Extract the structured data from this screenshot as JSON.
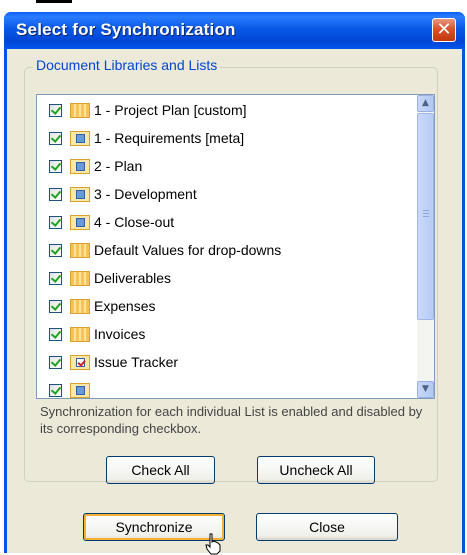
{
  "dialog": {
    "title": "Select for Synchronization",
    "close_glyph": "✕"
  },
  "group": {
    "label": "Document Libraries and Lists"
  },
  "list": {
    "items": [
      {
        "label": "1 - Project Plan [custom]",
        "checked": true,
        "icon": "list-icon"
      },
      {
        "label": "1 - Requirements [meta]",
        "checked": true,
        "icon": "library-icon"
      },
      {
        "label": "2 - Plan",
        "checked": true,
        "icon": "library-icon"
      },
      {
        "label": "3 - Development",
        "checked": true,
        "icon": "library-icon"
      },
      {
        "label": "4 - Close-out",
        "checked": true,
        "icon": "library-icon"
      },
      {
        "label": "Default Values for drop-downs",
        "checked": true,
        "icon": "list-icon"
      },
      {
        "label": "Deliverables",
        "checked": true,
        "icon": "list-icon"
      },
      {
        "label": "Expenses",
        "checked": true,
        "icon": "list-icon"
      },
      {
        "label": "Invoices",
        "checked": true,
        "icon": "list-icon"
      },
      {
        "label": "Issue Tracker",
        "checked": true,
        "icon": "issue-icon"
      }
    ]
  },
  "info_text": "Synchronization for each individual List is enabled and disabled by its corresponding checkbox.",
  "buttons": {
    "check_all": "Check All",
    "uncheck_all": "Uncheck All",
    "synchronize": "Synchronize",
    "close": "Close"
  },
  "colors": {
    "titlebar": "#0058ee",
    "face": "#ece9d8",
    "group_label": "#0046d5"
  }
}
